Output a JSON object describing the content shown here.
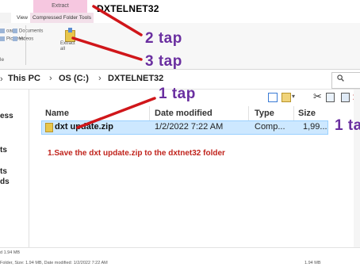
{
  "ribbon_tabs": {
    "file": "",
    "view": "View",
    "extract": "Extract",
    "compressed_tools": "Compressed Folder Tools"
  },
  "window_title": "DXTELNET32",
  "ribbon": {
    "items": [
      "oads",
      "Documents",
      "Pictures",
      "Videos"
    ],
    "extract_label": "Extract all",
    "caption": "le"
  },
  "breadcrumb": {
    "parts": [
      "This PC",
      "OS (C:)",
      "DXTELNET32"
    ]
  },
  "nav": {
    "items": [
      "ess",
      "ts",
      "ts",
      "ds"
    ]
  },
  "columns": {
    "name": "Name",
    "date_modified": "Date modified",
    "type": "Type",
    "size": "Size"
  },
  "file_row": {
    "name": "dxt update.zip",
    "date": "1/2/2022 7:22 AM",
    "type": "Comp...",
    "size": "1,99..."
  },
  "instruction": "1.Save the dxt update.zip to the dxtnet32 folder",
  "annotations": {
    "tap_2": "2 tap",
    "tap_3": "3 tap",
    "tap_1_center": "1 tap",
    "tap_1_right": "1 ta"
  },
  "status": {
    "left_top": "d 1.94 MB",
    "left": "Folder, Size: 1.94 MB, Date modified: 1/2/2022 7:22 AM",
    "right": "1.94 MB"
  },
  "colors": {
    "tap_purple": "#6a2fa0",
    "instruction_red": "#c0231c",
    "arrow_red": "#d0161a",
    "selection": "#cde8ff"
  }
}
